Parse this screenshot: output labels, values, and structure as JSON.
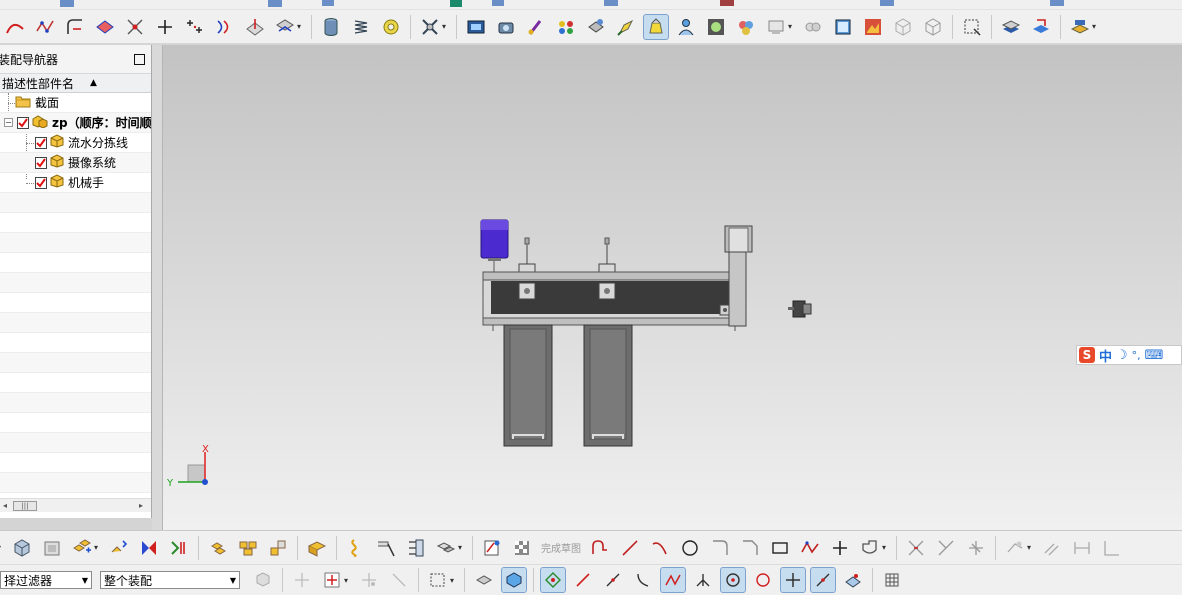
{
  "navigator": {
    "title": "装配导航器",
    "column_header": "描述性部件名",
    "sort_indicator": "▲",
    "rows": [
      {
        "label": "截面",
        "checked": false,
        "icon": "folder-icon"
      },
      {
        "label": "zp（顺序：时间顺",
        "checked": true,
        "icon": "assembly-icon"
      },
      {
        "label": "流水分拣线",
        "checked": true,
        "icon": "part-icon"
      },
      {
        "label": "摄像系统",
        "checked": true,
        "icon": "part-icon"
      },
      {
        "label": "机械手",
        "checked": true,
        "icon": "part-icon"
      }
    ]
  },
  "viewport": {
    "triad": {
      "x_label": "X",
      "y_label": "Y"
    }
  },
  "ime": {
    "logo": "S",
    "mode": "中",
    "moon": "☽",
    "punct": "°,",
    "keyboard": "⌨"
  },
  "sketch_toolbar": {
    "finish_sketch": "完成草图"
  },
  "filters": {
    "type_filter": "择过滤器",
    "scope_filter": "整个装配"
  },
  "colors": {
    "purple_motor": "#4b2bd0",
    "belt_dark": "#3a3a3a",
    "frame_gray": "#8a8a8a",
    "axis_x": "#e02020",
    "axis_y": "#1da31d",
    "axis_z": "#2050d0"
  }
}
